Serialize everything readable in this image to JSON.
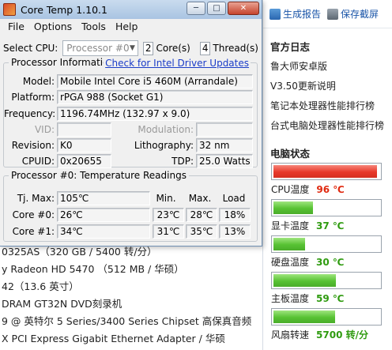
{
  "background": {
    "rows": [
      "0325AS（320 GB / 5400 转/分）",
      "y Radeon HD 5470 （512 MB / 华硕）",
      "42（13.6 英寸）",
      "DRAM GT32N DVD刻录机",
      "9 @ 英特尔 5 Series/3400 Series Chipset 高保真音频",
      "X PCI Express Gigabit Ethernet Adapter / 华硕"
    ]
  },
  "sidebar": {
    "generate_report": "生成报告",
    "save_screenshot": "保存截屏",
    "logs_title": "官方日志",
    "logs": [
      "鲁大师安卓版",
      "V3.50更新说明",
      "笔记本处理器性能排行榜",
      "台式电脑处理器性能排行榜"
    ],
    "status_title": "电脑状态",
    "meters": [
      {
        "label": "CPU温度",
        "value": "96 ℃",
        "fill": 0.98,
        "color": "red"
      },
      {
        "label": "显卡温度",
        "value": "37 ℃",
        "fill": 0.37,
        "color": "green"
      },
      {
        "label": "硬盘温度",
        "value": "30 ℃",
        "fill": 0.3,
        "color": "green"
      },
      {
        "label": "主板温度",
        "value": "59 ℃",
        "fill": 0.59,
        "color": "green"
      },
      {
        "label": "风扇转速",
        "value": "5700 转/分",
        "fill": 0.58,
        "color": "green"
      }
    ]
  },
  "coretemp": {
    "title": "Core Temp 1.10.1",
    "menu": [
      "File",
      "Options",
      "Tools",
      "Help"
    ],
    "select_cpu_label": "Select CPU:",
    "cpu_selected": "Processor #0",
    "cores": "2",
    "cores_label": "Core(s)",
    "threads": "4",
    "threads_label": "Thread(s)",
    "info_title": "Processor Information",
    "driver_link": "Check for Intel Driver Updates",
    "labels": {
      "model": "Model:",
      "platform": "Platform:",
      "frequency": "Frequency:",
      "vid": "VID:",
      "modulation": "Modulation:",
      "revision": "Revision:",
      "lithography": "Lithography:",
      "cpuid": "CPUID:",
      "tdp": "TDP:"
    },
    "values": {
      "model": "Mobile Intel Core i5 460M (Arrandale)",
      "platform": "rPGA 988 (Socket G1)",
      "frequency": "1196.74MHz (132.97 x 9.0)",
      "vid": "",
      "modulation": "",
      "revision": "K0",
      "lithography": "32 nm",
      "cpuid": "0x20655",
      "tdp": "25.0 Watts"
    },
    "temp_title": "Processor #0: Temperature Readings",
    "tj_label": "Tj. Max:",
    "tj_value": "105℃",
    "col_min": "Min.",
    "col_max": "Max.",
    "col_load": "Load",
    "cores_rows": [
      {
        "label": "Core #0:",
        "temp": "26℃",
        "min": "23℃",
        "max": "28℃",
        "load": "18%"
      },
      {
        "label": "Core #1:",
        "temp": "34℃",
        "min": "31℃",
        "max": "35℃",
        "load": "13%"
      }
    ]
  }
}
